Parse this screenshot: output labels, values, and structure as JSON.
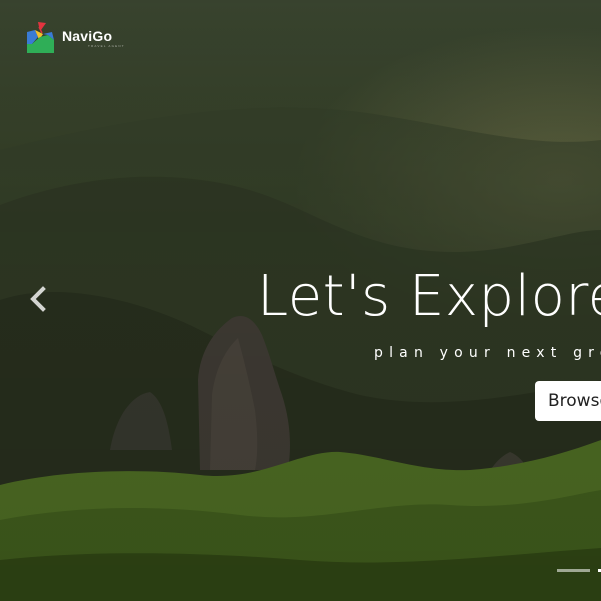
{
  "brand": {
    "name": "NaviGo",
    "tagline": "TRAVEL AGENT"
  },
  "hero": {
    "headline": "Let's Explore",
    "subheading": "plan your next great",
    "cta_label": "Browse"
  },
  "carousel": {
    "prev_icon": "chevron-left-icon",
    "indicators": [
      {
        "active": false
      },
      {
        "active": true
      }
    ]
  },
  "colors": {
    "logo_red": "#e2343f",
    "logo_blue": "#3a7bd5",
    "logo_yellow": "#f2c12e",
    "logo_green": "#2fae57",
    "button_bg": "#ffffff"
  }
}
